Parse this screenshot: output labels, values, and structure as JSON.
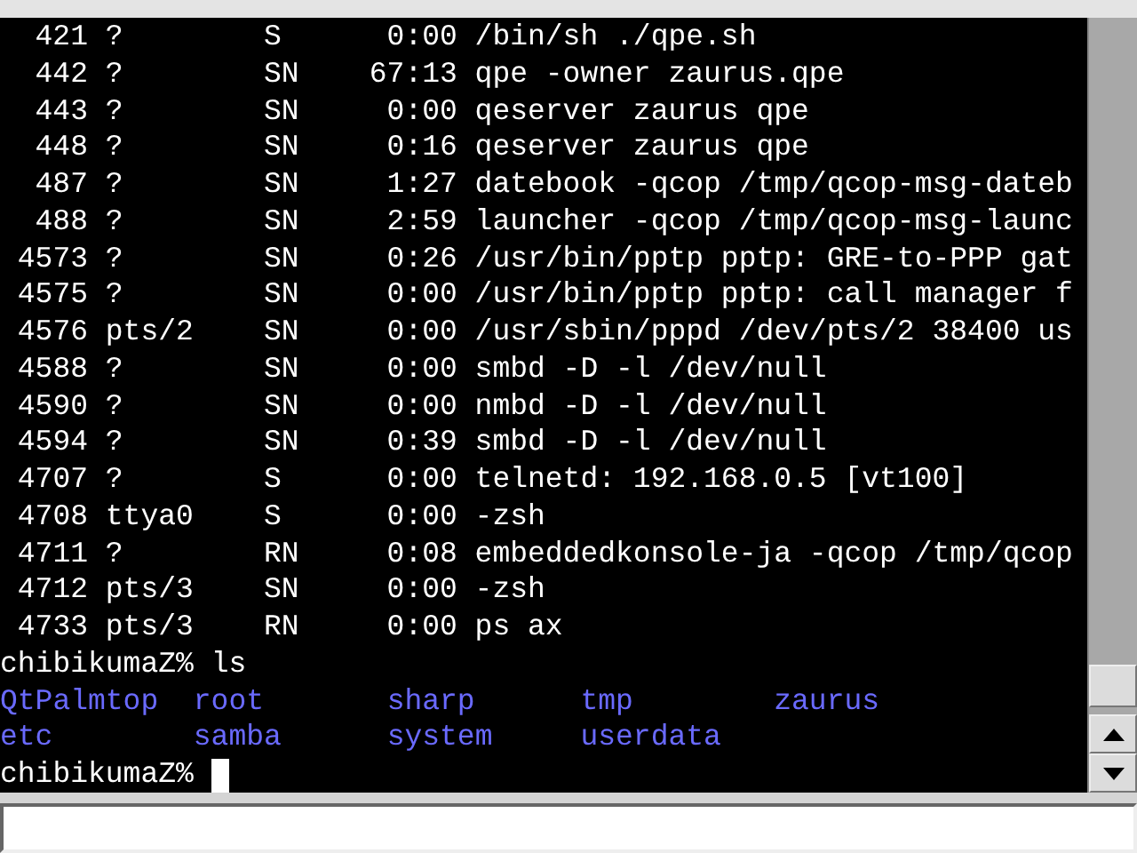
{
  "terminal": {
    "processes": [
      {
        "pid": "421",
        "tty": "?",
        "stat": "S",
        "time": "0:00",
        "command": "/bin/sh ./qpe.sh"
      },
      {
        "pid": "442",
        "tty": "?",
        "stat": "SN",
        "time": "67:13",
        "command": "qpe -owner zaurus.qpe"
      },
      {
        "pid": "443",
        "tty": "?",
        "stat": "SN",
        "time": "0:00",
        "command": "qeserver zaurus qpe"
      },
      {
        "pid": "448",
        "tty": "?",
        "stat": "SN",
        "time": "0:16",
        "command": "qeserver zaurus qpe"
      },
      {
        "pid": "487",
        "tty": "?",
        "stat": "SN",
        "time": "1:27",
        "command": "datebook -qcop /tmp/qcop-msg-dateb"
      },
      {
        "pid": "488",
        "tty": "?",
        "stat": "SN",
        "time": "2:59",
        "command": "launcher -qcop /tmp/qcop-msg-launc"
      },
      {
        "pid": "4573",
        "tty": "?",
        "stat": "SN",
        "time": "0:26",
        "command": "/usr/bin/pptp pptp: GRE-to-PPP gat"
      },
      {
        "pid": "4575",
        "tty": "?",
        "stat": "SN",
        "time": "0:00",
        "command": "/usr/bin/pptp pptp: call manager f"
      },
      {
        "pid": "4576",
        "tty": "pts/2",
        "stat": "SN",
        "time": "0:00",
        "command": "/usr/sbin/pppd /dev/pts/2 38400 us"
      },
      {
        "pid": "4588",
        "tty": "?",
        "stat": "SN",
        "time": "0:00",
        "command": "smbd -D -l /dev/null"
      },
      {
        "pid": "4590",
        "tty": "?",
        "stat": "SN",
        "time": "0:00",
        "command": "nmbd -D -l /dev/null"
      },
      {
        "pid": "4594",
        "tty": "?",
        "stat": "SN",
        "time": "0:39",
        "command": "smbd -D -l /dev/null"
      },
      {
        "pid": "4707",
        "tty": "?",
        "stat": "S",
        "time": "0:00",
        "command": "telnetd: 192.168.0.5 [vt100]"
      },
      {
        "pid": "4708",
        "tty": "ttya0",
        "stat": "S",
        "time": "0:00",
        "command": "-zsh"
      },
      {
        "pid": "4711",
        "tty": "?",
        "stat": "RN",
        "time": "0:08",
        "command": "embeddedkonsole-ja -qcop /tmp/qcop"
      },
      {
        "pid": "4712",
        "tty": "pts/3",
        "stat": "SN",
        "time": "0:00",
        "command": "-zsh"
      },
      {
        "pid": "4733",
        "tty": "pts/3",
        "stat": "RN",
        "time": "0:00",
        "command": "ps ax"
      }
    ],
    "command_line": {
      "prompt": "chibikumaZ%",
      "command": "ls"
    },
    "ls_rows": [
      [
        "QtPalmtop",
        "root",
        "sharp",
        "tmp",
        "zaurus"
      ],
      [
        "etc",
        "samba",
        "system",
        "userdata"
      ]
    ],
    "current_prompt": "chibikumaZ%"
  }
}
